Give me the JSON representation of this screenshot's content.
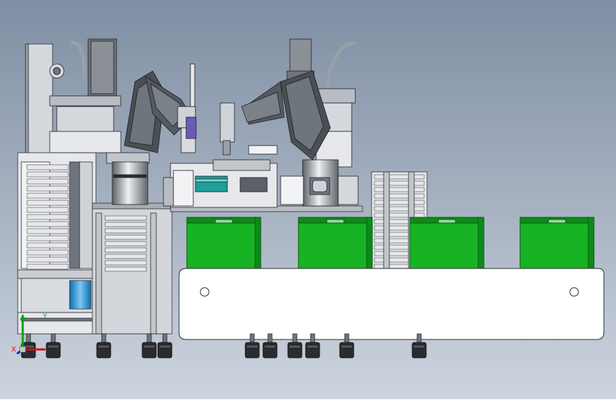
{
  "viewport": {
    "background_top": "#7f8ea3",
    "background_bottom": "#ccd4de"
  },
  "colors": {
    "bin_green": "#17b324",
    "bin_green_dark": "#0e8a19",
    "frame_gray": "#c9ccd0",
    "metal_light": "#e6e8eb",
    "metal_dark": "#6f757c",
    "robot_dark": "#4a4e55",
    "teal_part": "#1f9e9a",
    "line": "#2b2d31"
  },
  "triad": {
    "x_label": "X",
    "y_label": "Y",
    "x_color": "#d01010",
    "y_color": "#10a010",
    "z_color": "#1030d0"
  }
}
